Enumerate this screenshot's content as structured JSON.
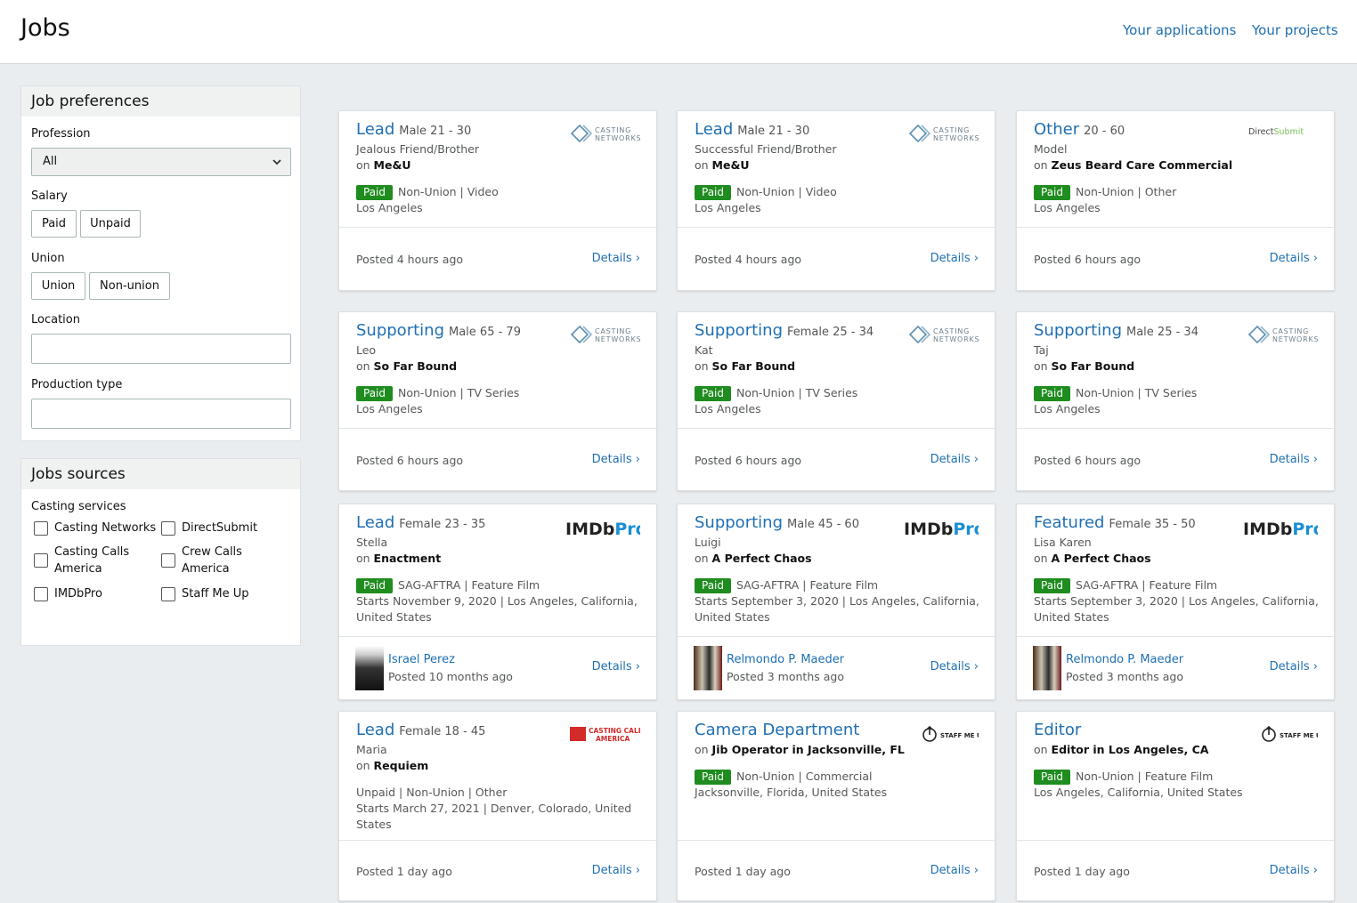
{
  "header": {
    "title": "Jobs",
    "links": [
      "Your applications",
      "Your projects"
    ]
  },
  "preferences": {
    "title": "Job preferences",
    "profession_label": "Profession",
    "profession_value": "All",
    "salary_label": "Salary",
    "salary_options": [
      "Paid",
      "Unpaid"
    ],
    "union_label": "Union",
    "union_options": [
      "Union",
      "Non-union"
    ],
    "location_label": "Location",
    "production_label": "Production type"
  },
  "sources": {
    "title": "Jobs sources",
    "casting_label": "Casting services",
    "items": [
      "Casting Networks",
      "DirectSubmit",
      "Casting Calls America",
      "Crew Calls America",
      "IMDbPro",
      "Staff Me Up"
    ]
  },
  "details_label": "Details ›",
  "logos": {
    "casting_networks": [
      "CASTING",
      "NETWORKS"
    ],
    "direct_submit": "DirectSubmit",
    "imdbpro": [
      "IMDb",
      "Pro"
    ],
    "casting_calls_america": [
      "CASTING CALLS",
      "AMERICA"
    ],
    "staff_me_up": "STAFF ME UP"
  },
  "jobs": [
    {
      "role": "Lead",
      "demo": "Male 21 - 30",
      "character": "Jealous Friend/Brother",
      "on_prefix": "on ",
      "project": "Me&U",
      "badge": "Paid",
      "tags": "Non-Union | Video",
      "location": "Los Angeles",
      "posted": "Posted 4 hours ago",
      "source": "casting_networks"
    },
    {
      "role": "Lead",
      "demo": "Male 21 - 30",
      "character": "Successful Friend/Brother",
      "on_prefix": "on ",
      "project": "Me&U",
      "badge": "Paid",
      "tags": "Non-Union | Video",
      "location": "Los Angeles",
      "posted": "Posted 4 hours ago",
      "source": "casting_networks"
    },
    {
      "role": "Other",
      "demo": "20 - 60",
      "character": "Model",
      "on_prefix": "on ",
      "project": "Zeus Beard Care Commercial",
      "badge": "Paid",
      "tags": "Non-Union | Other",
      "location": "Los Angeles",
      "posted": "Posted 6 hours ago",
      "source": "direct_submit"
    },
    {
      "role": "Supporting",
      "demo": "Male 65 - 79",
      "character": "Leo",
      "on_prefix": "on ",
      "project": "So Far Bound",
      "badge": "Paid",
      "tags": "Non-Union | TV Series",
      "location": "Los Angeles",
      "posted": "Posted 6 hours ago",
      "source": "casting_networks"
    },
    {
      "role": "Supporting",
      "demo": "Female 25 - 34",
      "character": "Kat",
      "on_prefix": "on ",
      "project": "So Far Bound",
      "badge": "Paid",
      "tags": "Non-Union | TV Series",
      "location": "Los Angeles",
      "posted": "Posted 6 hours ago",
      "source": "casting_networks"
    },
    {
      "role": "Supporting",
      "demo": "Male 25 - 34",
      "character": "Taj",
      "on_prefix": "on ",
      "project": "So Far Bound",
      "badge": "Paid",
      "tags": "Non-Union | TV Series",
      "location": "Los Angeles",
      "posted": "Posted 6 hours ago",
      "source": "casting_networks"
    },
    {
      "role": "Lead",
      "demo": "Female 23 - 35",
      "character": "Stella",
      "on_prefix": "on ",
      "project": "Enactment",
      "badge": "Paid",
      "tags": "SAG-AFTRA | Feature Film",
      "starts": "Starts November 9, 2020 | Los Angeles, California,",
      "starts2": "United States",
      "person": "Israel Perez",
      "posted": "Posted 10 months ago",
      "source": "imdbpro"
    },
    {
      "role": "Supporting",
      "demo": "Male 45 - 60",
      "character": "Luigi",
      "on_prefix": "on ",
      "project": "A Perfect Chaos",
      "badge": "Paid",
      "tags": "SAG-AFTRA | Feature Film",
      "starts": "Starts September 3, 2020 | Los Angeles, California,",
      "starts2": "United States",
      "person": "Relmondo P. Maeder",
      "posted": "Posted 3 months ago",
      "source": "imdbpro"
    },
    {
      "role": "Featured",
      "demo": "Female 35 - 50",
      "character": "Lisa Karen",
      "on_prefix": "on ",
      "project": "A Perfect Chaos",
      "badge": "Paid",
      "tags": "SAG-AFTRA | Feature Film",
      "starts": "Starts September 3, 2020 | Los Angeles, California,",
      "starts2": "United States",
      "person": "Relmondo P. Maeder",
      "posted": "Posted 3 months ago",
      "source": "imdbpro"
    },
    {
      "role": "Lead",
      "demo": "Female 18 - 45",
      "character": "Maria",
      "on_prefix": "on ",
      "project": "Requiem",
      "tags": "Unpaid | Non-Union | Other",
      "starts": "Starts March 27, 2021 | Denver, Colorado, United",
      "starts2": "States",
      "posted": "Posted 1 day ago",
      "source": "casting_calls_america"
    },
    {
      "role": "Camera Department",
      "on_prefix": "on ",
      "project": "Jib Operator in Jacksonville, FL",
      "badge": "Paid",
      "tags": "Non-Union | Commercial",
      "location": "Jacksonville, Florida, United States",
      "posted": "Posted 1 day ago",
      "source": "staff_me_up"
    },
    {
      "role": "Editor",
      "on_prefix": "on ",
      "project": "Editor in Los Angeles, CA",
      "badge": "Paid",
      "tags": "Non-Union | Feature Film",
      "location": "Los Angeles, California, United States",
      "posted": "Posted 1 day ago",
      "source": "staff_me_up"
    }
  ]
}
